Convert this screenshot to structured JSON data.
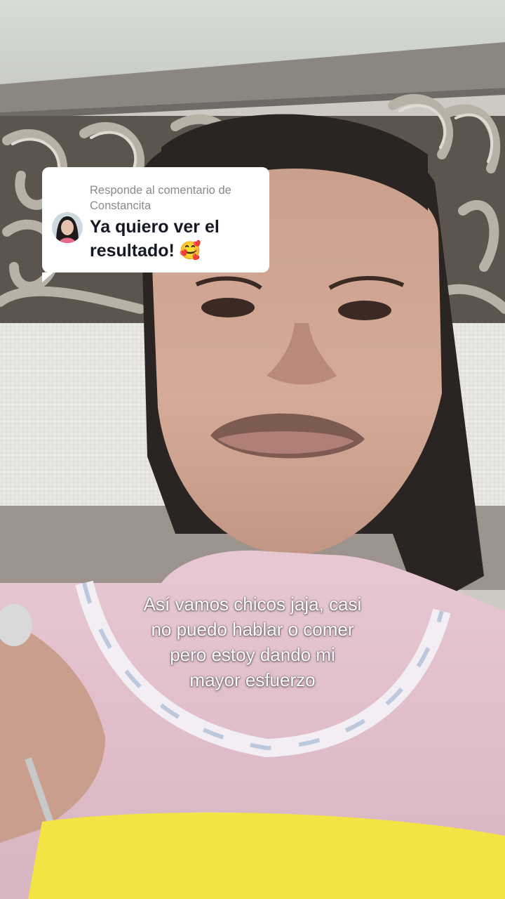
{
  "reply_comment": {
    "meta": "Responde al comentario de Constancita",
    "text": "Ya quiero ver el resultado!",
    "emoji": "🥰"
  },
  "caption": {
    "line1": "Así vamos chicos jaja, casi",
    "line2": "no puedo hablar o comer",
    "line3": "pero estoy dando mi",
    "line4": "mayor esfuerzo"
  },
  "colors": {
    "card_background": "#ffffff",
    "meta_text": "#8a8a8a",
    "reply_text": "#161823",
    "caption_text": "#ffffff"
  },
  "icons": [
    "commenter-avatar"
  ]
}
